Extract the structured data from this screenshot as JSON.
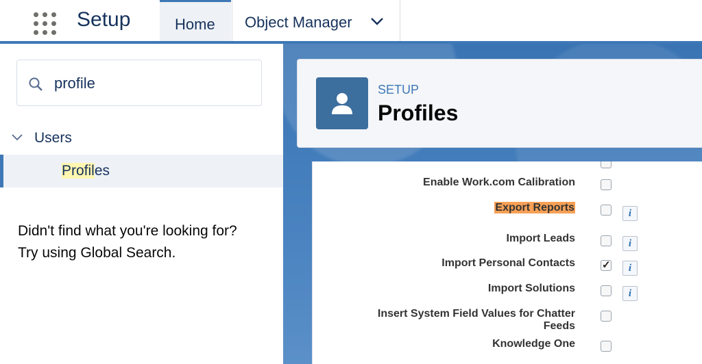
{
  "header": {
    "app_title": "Setup",
    "tabs": [
      {
        "label": "Home",
        "active": true
      },
      {
        "label": "Object Manager",
        "active": false
      }
    ]
  },
  "sidebar": {
    "search": {
      "value": "profile",
      "placeholder": ""
    },
    "group": {
      "label": "Users"
    },
    "item": {
      "label_prefix": "Profil",
      "label_highlight": "es",
      "label": "Profiles"
    },
    "not_found_line1": "Didn't find what you're looking for?",
    "not_found_line2": "Try using Global Search."
  },
  "page_header": {
    "eyebrow": "SETUP",
    "title": "Profiles"
  },
  "permissions": [
    {
      "label": "Enable Work.com Calibration",
      "checked": false,
      "info": false,
      "highlight": false
    },
    {
      "label": "Export Reports",
      "checked": false,
      "info": true,
      "highlight": true
    },
    {
      "label": "Import Leads",
      "checked": false,
      "info": true,
      "highlight": false
    },
    {
      "label": "Import Personal Contacts",
      "checked": true,
      "info": true,
      "highlight": false
    },
    {
      "label": "Import Solutions",
      "checked": false,
      "info": true,
      "highlight": false
    },
    {
      "label": "Insert System Field Values for Chatter Feeds",
      "checked": false,
      "info": false,
      "highlight": false
    },
    {
      "label": "Knowledge One",
      "checked": false,
      "info": false,
      "highlight": false
    }
  ],
  "info_glyph": "i",
  "icons": [
    "app-launcher-icon",
    "chevron-down-icon",
    "search-icon",
    "user-icon",
    "info-icon"
  ],
  "colors": {
    "brand": "#3e78b6",
    "highlight_orange": "#f7a055",
    "highlight_yellow": "#fff6b0"
  }
}
